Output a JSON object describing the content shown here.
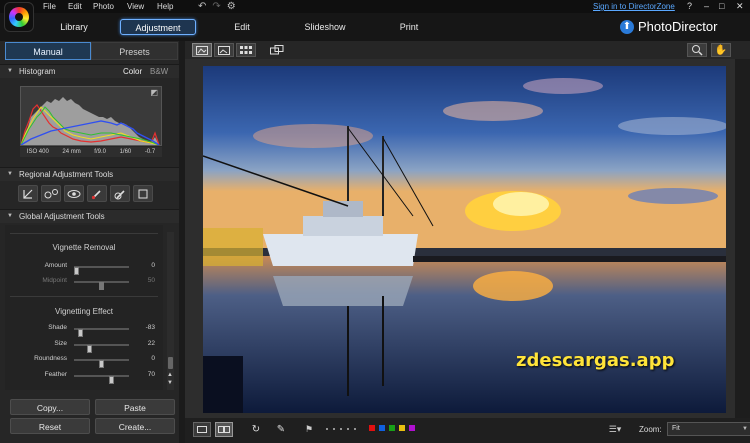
{
  "menu": {
    "items": [
      "File",
      "Edit",
      "Photo",
      "View",
      "Help"
    ],
    "signin": "Sign in to DirectorZone",
    "help": "?",
    "minimize": "–",
    "maximize": "□",
    "close": "✕"
  },
  "modules": {
    "tabs": [
      "Library",
      "Adjustment",
      "Edit",
      "Slideshow",
      "Print"
    ],
    "active": "Adjustment"
  },
  "brand": {
    "name": "PhotoDirector",
    "accent": "#2a7ad8"
  },
  "left_panel": {
    "tabs": [
      "Manual",
      "Presets"
    ],
    "histogram": {
      "title": "Histogram",
      "modes": [
        "Color",
        "B&W"
      ],
      "info": [
        "ISO 400",
        "24 mm",
        "f/9.0",
        "1/60",
        "-0.7"
      ]
    },
    "regional": {
      "title": "Regional Adjustment Tools"
    },
    "global": {
      "title": "Global Adjustment Tools",
      "vignette_removal": {
        "title": "Vignette Removal",
        "rows": [
          {
            "label": "Amount",
            "value": "0",
            "level": 0.0
          },
          {
            "label": "Midpoint",
            "value": "50",
            "level": 0.5
          }
        ]
      },
      "vignetting_effect": {
        "title": "Vignetting Effect",
        "rows": [
          {
            "label": "Shade",
            "value": "-83",
            "level": 0.08
          },
          {
            "label": "Size",
            "value": "22",
            "level": 0.25
          },
          {
            "label": "Roundness",
            "value": "0",
            "level": 0.5
          },
          {
            "label": "Feather",
            "value": "70",
            "level": 0.7
          }
        ]
      }
    },
    "buttons": {
      "copy": "Copy...",
      "paste": "Paste",
      "reset": "Reset",
      "create": "Create..."
    }
  },
  "viewer": {
    "watermark": "zdescargas.app"
  },
  "bottom": {
    "zoom_label": "Zoom:",
    "zoom_value": "Fit",
    "color_labels": [
      "#e01010",
      "#1060e0",
      "#18a018",
      "#e8c010",
      "#b010d0"
    ]
  }
}
